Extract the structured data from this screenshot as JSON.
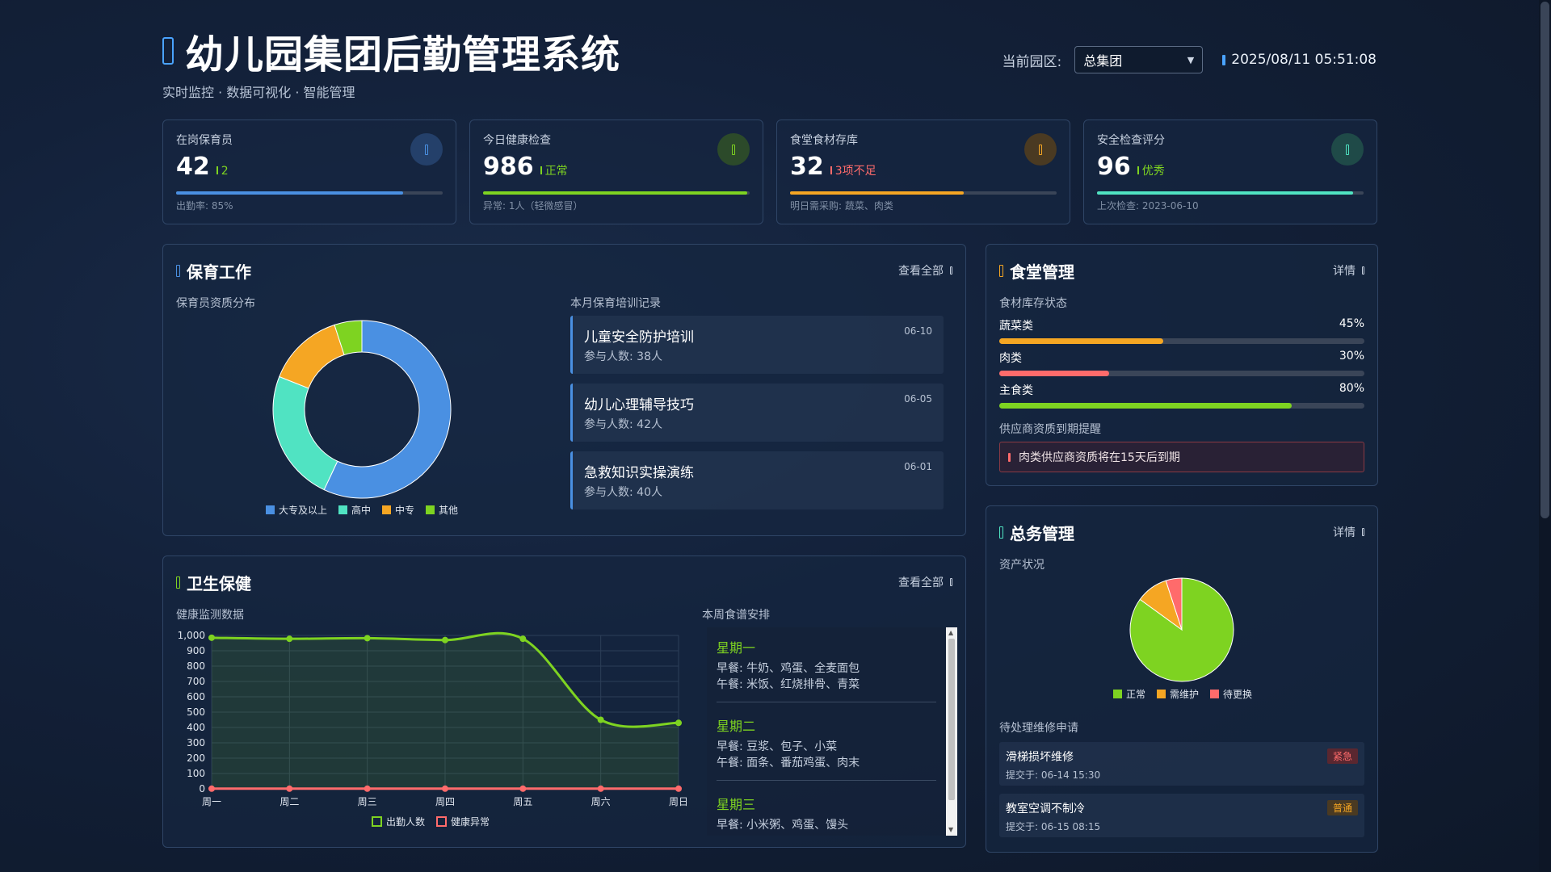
{
  "header": {
    "title": "幼儿园集团后勤管理系统",
    "subtitle": "实时监控 · 数据可视化 · 智能管理",
    "campus_label": "当前园区:",
    "campus_value": "总集团",
    "datetime": "2025/08/11 05:51:08"
  },
  "stats": [
    {
      "label": "在岗保育员",
      "value": "42",
      "trend": "2",
      "foot": "出勤率: 85%",
      "progress": 0.85,
      "color": "#4a90e2"
    },
    {
      "label": "今日健康检查",
      "value": "986",
      "trend": "正常",
      "foot": "异常: 1人（轻微感冒）",
      "progress": 0.99,
      "color": "#7ed321"
    },
    {
      "label": "食堂食材存库",
      "value": "32",
      "trend": "3项不足",
      "foot": "明日需采购: 蔬菜、肉类",
      "progress": 0.65,
      "color": "#f5a623"
    },
    {
      "label": "安全检查评分",
      "value": "96",
      "trend": "优秀",
      "foot": "上次检查: 2023-06-10",
      "progress": 0.96,
      "color": "#50e3c2"
    }
  ],
  "care": {
    "title": "保育工作",
    "link": "查看全部",
    "dist_label": "保育员资质分布",
    "training_label": "本月保育培训记录",
    "legend": [
      "大专及以上",
      "高中",
      "中专",
      "其他"
    ],
    "trainings": [
      {
        "title": "儿童安全防护培训",
        "count": "参与人数: 38人",
        "date": "06-10"
      },
      {
        "title": "幼儿心理辅导技巧",
        "count": "参与人数: 42人",
        "date": "06-05"
      },
      {
        "title": "急救知识实操演练",
        "count": "参与人数: 40人",
        "date": "06-01"
      }
    ]
  },
  "canteen": {
    "title": "食堂管理",
    "link": "详情",
    "stock_label": "食材库存状态",
    "items": [
      {
        "name": "蔬菜类",
        "pct": "45%",
        "value": 0.45,
        "color": "#f5a623"
      },
      {
        "name": "肉类",
        "pct": "30%",
        "value": 0.3,
        "color": "#ff6b6b"
      },
      {
        "name": "主食类",
        "pct": "80%",
        "value": 0.8,
        "color": "#7ed321"
      }
    ],
    "supplier_label": "供应商资质到期提醒",
    "alert": "肉类供应商资质将在15天后到期"
  },
  "general": {
    "title": "总务管理",
    "link": "详情",
    "asset_label": "资产状况",
    "legend": [
      "正常",
      "需维护",
      "待更换"
    ],
    "repair_label": "待处理维修申请",
    "repairs": [
      {
        "title": "滑梯损坏维修",
        "time": "提交于: 06-14 15:30",
        "badge": "紧急"
      },
      {
        "title": "教室空调不制冷",
        "time": "提交于: 06-15 08:15",
        "badge": "普通"
      }
    ]
  },
  "health": {
    "title": "卫生保健",
    "link": "查看全部",
    "monitor_label": "健康监测数据",
    "menu_label": "本周食谱安排",
    "legend": [
      "出勤人数",
      "健康异常"
    ],
    "menu": [
      {
        "day": "星期一",
        "lines": [
          "早餐: 牛奶、鸡蛋、全麦面包",
          "午餐: 米饭、红烧排骨、青菜"
        ]
      },
      {
        "day": "星期二",
        "lines": [
          "早餐: 豆浆、包子、小菜",
          "午餐: 面条、番茄鸡蛋、肉末"
        ]
      },
      {
        "day": "星期三",
        "lines": [
          "早餐: 小米粥、鸡蛋、馒头"
        ]
      }
    ]
  },
  "chart_data": [
    {
      "type": "pie",
      "variant": "donut",
      "categories": [
        "大专及以上",
        "高中",
        "中专",
        "其他"
      ],
      "values": [
        57,
        24,
        14,
        5
      ],
      "colors": [
        "#4a90e2",
        "#50e3c2",
        "#f5a623",
        "#7ed321"
      ]
    },
    {
      "type": "line",
      "categories": [
        "周一",
        "周二",
        "周三",
        "周四",
        "周五",
        "周六",
        "周日"
      ],
      "series": [
        {
          "name": "出勤人数",
          "values": [
            985,
            978,
            982,
            970,
            978,
            450,
            430
          ],
          "color": "#7ed321"
        },
        {
          "name": "健康异常",
          "values": [
            1,
            1,
            1,
            1,
            1,
            1,
            1
          ],
          "color": "#ff6b6b"
        }
      ],
      "ylim": [
        0,
        1000
      ],
      "yticks": [
        "1,000",
        "900",
        "800",
        "700",
        "600",
        "500",
        "400",
        "300",
        "200",
        "100",
        "0"
      ],
      "grid": true
    },
    {
      "type": "pie",
      "categories": [
        "正常",
        "需维护",
        "待更换"
      ],
      "values": [
        85,
        10,
        5
      ],
      "colors": [
        "#7ed321",
        "#f5a623",
        "#ff6b6b"
      ]
    }
  ]
}
